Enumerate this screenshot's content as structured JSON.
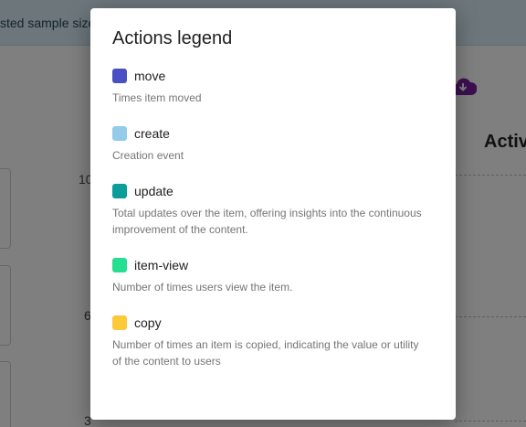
{
  "background": {
    "banner_text": "sted sample size",
    "chart_title": "Activ",
    "y_ticks": [
      "10",
      "6",
      "3"
    ]
  },
  "modal": {
    "title": "Actions legend",
    "items": [
      {
        "name": "move",
        "color": "#4a4fc4",
        "description": "Times item moved"
      },
      {
        "name": "create",
        "color": "#93cbe8",
        "description": "Creation event"
      },
      {
        "name": "update",
        "color": "#0b9d9a",
        "description": "Total updates over the item, offering insights into the continuous improvement of the content."
      },
      {
        "name": "item-view",
        "color": "#26de8f",
        "description": "Number of times users view the item."
      },
      {
        "name": "copy",
        "color": "#fcc93a",
        "description": "Number of times an item is copied, indicating the value or utility of the content to users"
      }
    ]
  }
}
